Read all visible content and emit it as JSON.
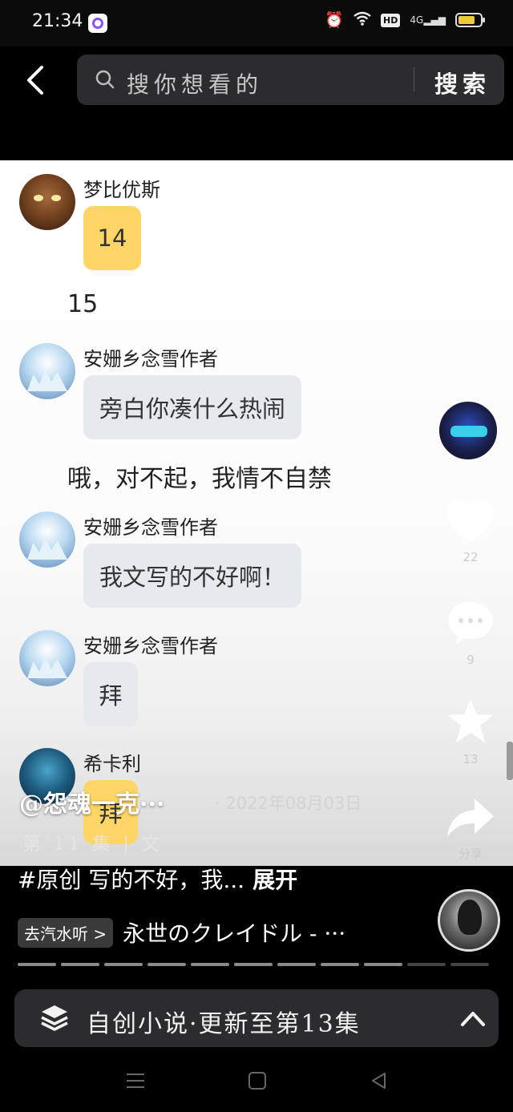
{
  "status_bar": {
    "time": "21:34",
    "hd": "HD",
    "signal": "4G",
    "battery_level": 0.75,
    "battery_color": "#f0c83c"
  },
  "header": {
    "search_placeholder": "搜你想看的",
    "search_button": "搜索"
  },
  "chat": [
    {
      "name": "梦比优斯",
      "bubble": "14",
      "style": "yellow",
      "avatar": "hero"
    },
    {
      "narration": "15"
    },
    {
      "name": "安姗乡念雪作者",
      "bubble": "旁白你凑什么热闹",
      "style": "gray",
      "avatar": "snow"
    },
    {
      "narration": "哦，对不起，我情不自禁"
    },
    {
      "name": "安姗乡念雪作者",
      "bubble": "我文写的不好啊！",
      "style": "gray",
      "avatar": "snow"
    },
    {
      "name": "安姗乡念雪作者",
      "bubble": "拜",
      "style": "gray",
      "avatar": "snow"
    },
    {
      "name": "希卡利",
      "bubble": "拜",
      "style": "yellow",
      "avatar": "armor"
    }
  ],
  "actions": {
    "like_count": "22",
    "comment_count": "9",
    "favorite_count": "13",
    "share_label": "分享"
  },
  "video_info": {
    "author": "@怨魂一克···",
    "date": "· 2022年08月03日",
    "episode": "第 11 集 | 文",
    "description": "#原创 写的不好，我...",
    "expand": "展开",
    "music_chip": "去汽水听 >",
    "music_title": "永世のクレイドル - ···"
  },
  "progress": {
    "segments": 11,
    "watched": 9
  },
  "collection": {
    "label": "自创小说·更新至第13集"
  },
  "icons": {
    "back": "back-arrow-icon",
    "search": "search-icon",
    "like": "heart-icon",
    "comment": "comment-bubble-icon",
    "favorite": "star-icon",
    "share": "share-arrow-icon",
    "collection": "layers-icon",
    "expand": "chevron-up-icon"
  }
}
